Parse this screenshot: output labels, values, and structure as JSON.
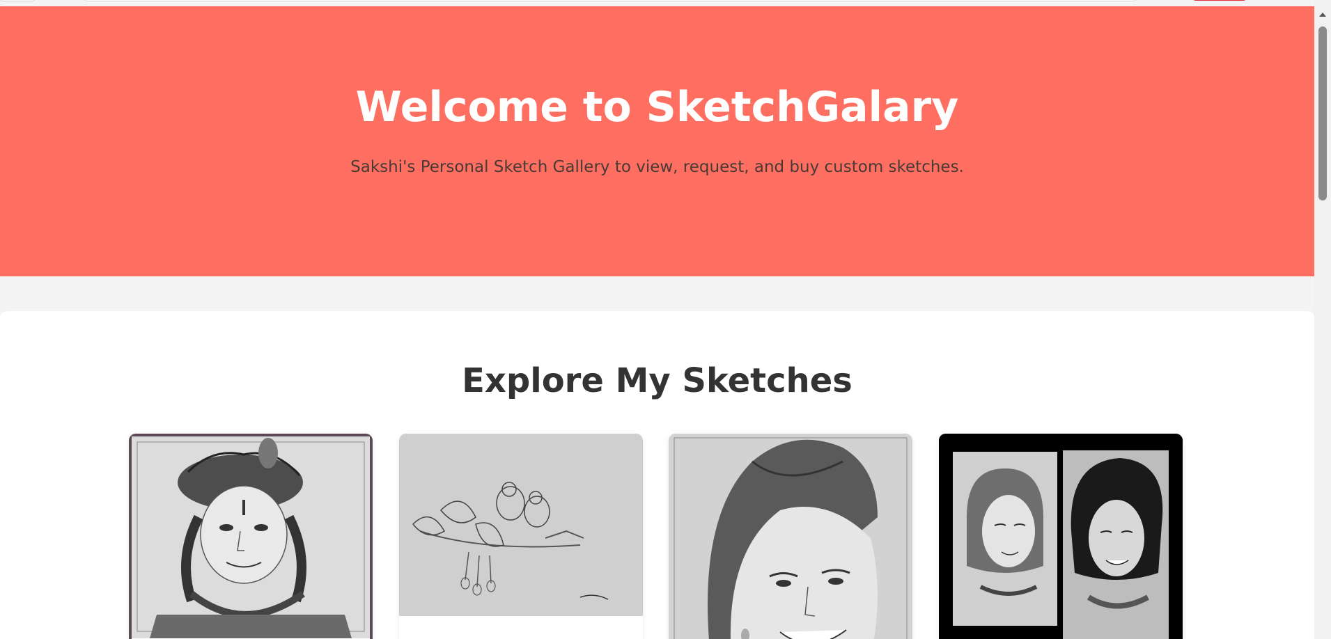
{
  "hero": {
    "title": "Welcome to SketchGalary",
    "subtitle": "Sakshi's Personal Sketch Gallery to view, request, and buy custom sketches."
  },
  "gallery": {
    "heading": "Explore My Sketches",
    "cards": [
      {
        "subject": "krishna-portrait-sketch"
      },
      {
        "subject": "birds-on-branch-sketch"
      },
      {
        "subject": "smiling-woman-portrait-sketch"
      },
      {
        "subject": "side-by-side-portrait-comparison"
      }
    ]
  },
  "colors": {
    "hero_bg": "#ff6f61",
    "hero_title": "#ffffff",
    "page_bg": "#f4f4f4",
    "heading": "#333333",
    "accent_red": "#e0313a"
  }
}
